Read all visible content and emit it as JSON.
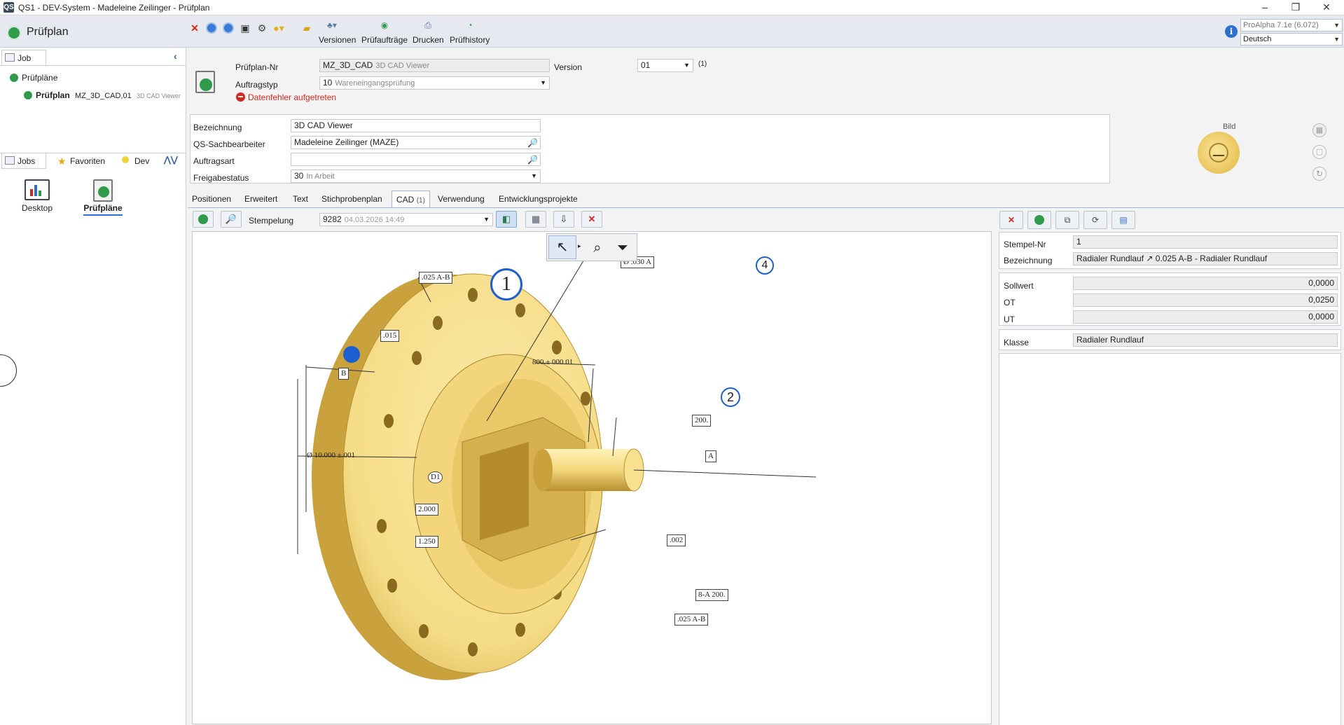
{
  "window": {
    "title": "QS1 - DEV-System - Madeleine Zeilinger - Prüfplan",
    "app_icon": "QS"
  },
  "header": {
    "module_title": "Prüfplan",
    "toolbar": {
      "versionen": "Versionen",
      "pruefauftraege": "Prüfaufträge",
      "drucken": "Drucken",
      "pruefhistory": "Prüfhistory"
    },
    "info": "i",
    "product_select": "ProAlpha 7.1e (6.072)",
    "language_select": "Deutsch"
  },
  "left_panel": {
    "tab_job": "Job",
    "tree": {
      "root": "Prüfpläne",
      "item_bold": "Prüfplan",
      "item_code": "MZ_3D_CAD,01",
      "item_desc": "3D CAD Viewer"
    },
    "bottom_tabs": {
      "jobs": "Jobs",
      "favoriten": "Favoriten",
      "dev": "Dev"
    },
    "launchers": {
      "desktop": "Desktop",
      "pruefplaene": "Prüfpläne"
    }
  },
  "form": {
    "pruefplan_nr_label": "Prüfplan-Nr",
    "pruefplan_nr_value": "MZ_3D_CAD",
    "pruefplan_nr_sub": "3D CAD Viewer",
    "version_label": "Version",
    "version_value": "01",
    "version_count": "(1)",
    "auftragstyp_label": "Auftragstyp",
    "auftragstyp_value": "10",
    "auftragstyp_sub": "Wareneingangsprüfung",
    "error_text": "Datenfehler aufgetreten",
    "bezeichnung_label": "Bezeichnung",
    "bezeichnung_value": "3D CAD Viewer",
    "qs_label": "QS-Sachbearbeiter",
    "qs_value": "Madeleine Zeilinger (MAZE)",
    "auftragsart_label": "Auftragsart",
    "auftragsart_value": "",
    "freigabe_label": "Freigabestatus",
    "freigabe_value": "30",
    "freigabe_sub": "In Arbeit",
    "bild_label": "Bild"
  },
  "tabs": [
    {
      "label": "Positionen"
    },
    {
      "label": "Erweitert"
    },
    {
      "label": "Text"
    },
    {
      "label": "Stichprobenplan"
    },
    {
      "label": "CAD",
      "count": "(1)"
    },
    {
      "label": "Verwendung"
    },
    {
      "label": "Entwicklungsprojekte"
    }
  ],
  "cad": {
    "stempelung_label": "Stempelung",
    "stempelung_value": "9282",
    "stempelung_date": "04.03.2026 14:49",
    "annotations": {
      "a1": ".025 A-B",
      "a2": ".015",
      "a3": "Ø .030 A",
      "a4": "800.± 000.01",
      "a5": "B",
      "a6": "Ø  10.000 ±.001",
      "a7": "D1",
      "a8": "2.000",
      "a9": "1.250",
      "a10": ".002",
      "a11": "A",
      "a12": "200.",
      "a13": "8-A 200.",
      "a14": ".025 A-B"
    },
    "balloons": {
      "b1": "1",
      "b2": "2",
      "b4": "4"
    }
  },
  "detail": {
    "stempel_nr_label": "Stempel-Nr",
    "stempel_nr_value": "1",
    "bezeichnung_label": "Bezeichnung",
    "bezeichnung_value": "Radialer Rundlauf ↗ 0.025 A-B - Radialer Rundlauf",
    "sollwert_label": "Sollwert",
    "sollwert_value": "0,0000",
    "ot_label": "OT",
    "ot_value": "0,0250",
    "ut_label": "UT",
    "ut_value": "0,0000",
    "klasse_label": "Klasse",
    "klasse_value": "Radialer Rundlauf"
  },
  "colors": {
    "part_fill": "#f5dc86",
    "part_shadow": "#b8902e",
    "balloon_blue": "#1b5fd1",
    "error_red": "#d9261c",
    "accent_green": "#2f9a4a"
  }
}
